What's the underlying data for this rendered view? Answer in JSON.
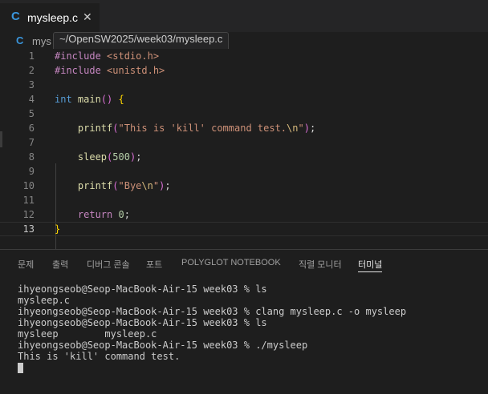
{
  "tab": {
    "label": "mysleep.c",
    "icon": "C",
    "close": "✕"
  },
  "breadcrumb": {
    "icon": "C",
    "label": "mys"
  },
  "tooltip": {
    "path": "~/OpenSW2025/week03/mysleep.c"
  },
  "editor": {
    "line_numbers": [
      "1",
      "2",
      "3",
      "4",
      "5",
      "6",
      "7",
      "8",
      "9",
      "10",
      "11",
      "12",
      "13"
    ],
    "current_line": 13,
    "lines": [
      {
        "directive": "#include",
        "header": "<stdio.h>"
      },
      {
        "directive": "#include",
        "header": "<unistd.h>"
      },
      {},
      {
        "type": "int",
        "func": "main",
        "parens": "()",
        "brace": "{"
      },
      {},
      {
        "func": "printf",
        "str_open": "\"This is 'kill' command test.",
        "esc": "\\n",
        "str_close": "\"",
        "tail": ";"
      },
      {},
      {
        "func": "sleep",
        "num": "500",
        "tail": ";"
      },
      {},
      {
        "func": "printf",
        "str_open": "\"Bye",
        "esc": "\\n",
        "str_close": "\"",
        "tail": ";"
      },
      {},
      {
        "kw": "return",
        "num": "0",
        "tail": ";"
      },
      {
        "brace": "}"
      }
    ]
  },
  "panel": {
    "tabs": [
      {
        "label": "문제"
      },
      {
        "label": "출력"
      },
      {
        "label": "디버그 콘솔"
      },
      {
        "label": "포트"
      },
      {
        "label": "POLYGLOT NOTEBOOK"
      },
      {
        "label": "직렬 모니터"
      },
      {
        "label": "터미널"
      }
    ],
    "active_tab": "터미널"
  },
  "terminal": {
    "lines": [
      "ihyeongseob@Seop-MacBook-Air-15 week03 % ls",
      "mysleep.c",
      "ihyeongseob@Seop-MacBook-Air-15 week03 % clang mysleep.c -o mysleep",
      "ihyeongseob@Seop-MacBook-Air-15 week03 % ls",
      "mysleep        mysleep.c",
      "ihyeongseob@Seop-MacBook-Air-15 week03 % ./mysleep",
      "This is 'kill' command test."
    ]
  },
  "colors": {
    "background": "#1e1e1e",
    "c_icon": "#3a96dd",
    "keyword": "#c586c0",
    "type": "#569cd6",
    "function": "#dcdcaa",
    "string": "#ce9178",
    "number": "#b5cea8"
  }
}
